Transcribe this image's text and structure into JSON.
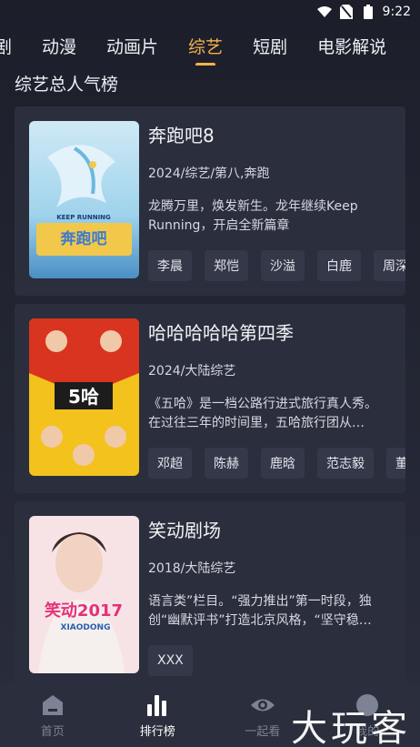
{
  "status_bar": {
    "time": "9:22"
  },
  "tabs": [
    {
      "label": "剧"
    },
    {
      "label": "动漫"
    },
    {
      "label": "动画片"
    },
    {
      "label": "综艺",
      "active": true
    },
    {
      "label": "短剧"
    },
    {
      "label": "电影解说"
    }
  ],
  "section_title": "综艺总人气榜",
  "shows": [
    {
      "title": "奔跑吧8",
      "meta": "2024/综艺/第八,奔跑",
      "description": "龙腾万里，焕发新生。龙年继续Keep Running，开启全新篇章",
      "cast": [
        "李晨",
        "郑恺",
        "沙溢",
        "白鹿",
        "周深"
      ],
      "poster_text": "奔跑吧",
      "poster_subtext": "KEEP RUNNING"
    },
    {
      "title": "哈哈哈哈哈第四季",
      "meta": "2024/大陆综艺",
      "description": "《五哈》是一档公路行进式旅行真人秀。在过往三年的时间里，五哈旅行团从…",
      "cast": [
        "邓超",
        "陈赫",
        "鹿晗",
        "范志毅",
        "董"
      ],
      "poster_text": "5哈"
    },
    {
      "title": "笑动剧场",
      "meta": "2018/大陆综艺",
      "description": "语言类”栏目。“强力推出”第一时段，独创“幽默评书”打造北京风格，“坚守稳…",
      "cast": [
        "XXX"
      ],
      "poster_text": "笑动2017",
      "poster_subtext": "XIAODONG"
    }
  ],
  "bottom_nav": [
    {
      "label": "首页",
      "icon": "home-icon"
    },
    {
      "label": "排行榜",
      "icon": "chart-icon",
      "active": true
    },
    {
      "label": "一起看",
      "icon": "eye-icon"
    },
    {
      "label": "我的",
      "icon": "user-icon"
    }
  ],
  "watermark": "大玩客",
  "colors": {
    "accent": "#f3b24a",
    "background": "#1f2230",
    "card": "#2b2e3d"
  }
}
